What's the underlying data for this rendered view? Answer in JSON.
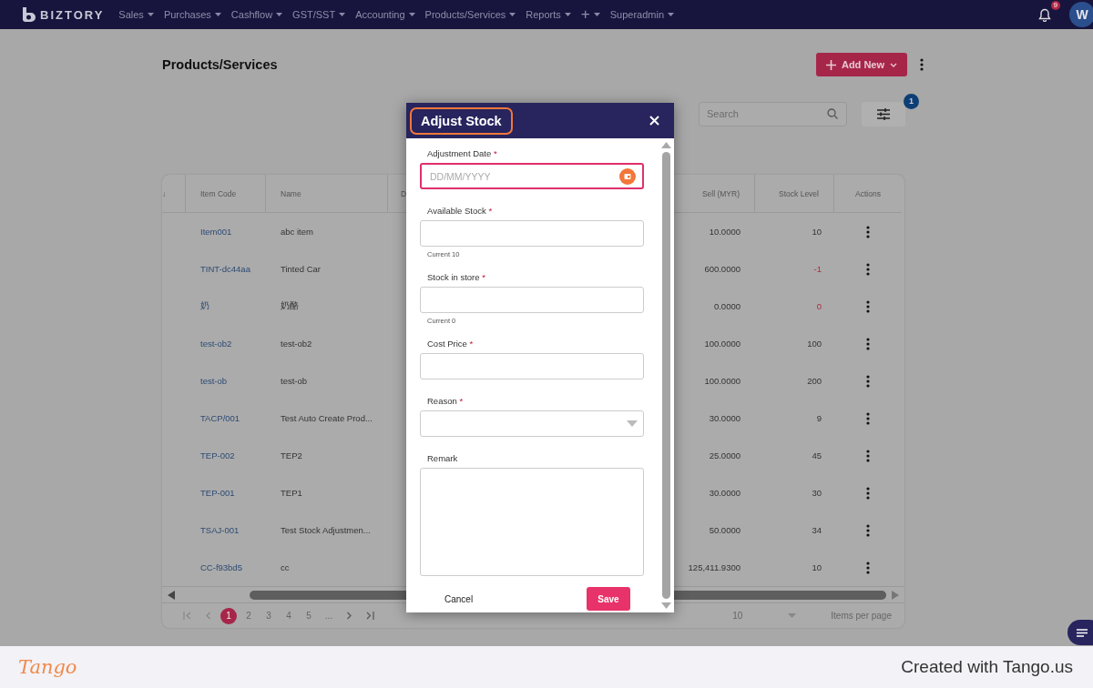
{
  "nav": {
    "brand": "BIZTORY",
    "menu": [
      {
        "label": "Sales"
      },
      {
        "label": "Purchases"
      },
      {
        "label": "Cashflow"
      },
      {
        "label": "GST/SST"
      },
      {
        "label": "Accounting"
      },
      {
        "label": "Products/Services"
      },
      {
        "label": "Reports"
      },
      {
        "label": "+"
      },
      {
        "label": "Superadmin"
      }
    ],
    "notification_count": "9",
    "avatar": "W"
  },
  "page": {
    "title": "Products/Services",
    "add_button": "Add New",
    "search": {
      "placeholder": "Search"
    },
    "filter_count": "1"
  },
  "table": {
    "columns": [
      "↓",
      "Item Code",
      "Name",
      "D",
      "Sell (MYR)",
      "Stock Level",
      "Actions"
    ],
    "rows": [
      {
        "item_code": "Item001",
        "name": "abc item",
        "sell": "10.0000",
        "stock_level": "10",
        "low_stock": false
      },
      {
        "item_code": "TINT-dc44aa",
        "name": "Tinted Car",
        "sell": "600.0000",
        "stock_level": "-1",
        "low_stock": true
      },
      {
        "item_code": "奶",
        "name": "奶酪",
        "sell": "0.0000",
        "stock_level": "0",
        "low_stock": true
      },
      {
        "item_code": "test-ob2",
        "name": "test-ob2",
        "sell": "100.0000",
        "stock_level": "100",
        "low_stock": false
      },
      {
        "item_code": "test-ob",
        "name": "test-ob",
        "sell": "100.0000",
        "stock_level": "200",
        "low_stock": false
      },
      {
        "item_code": "TACP/001",
        "name": "Test Auto Create Prod...",
        "sell": "30.0000",
        "stock_level": "9",
        "low_stock": false
      },
      {
        "item_code": "TEP-002",
        "name": "TEP2",
        "sell": "25.0000",
        "stock_level": "45",
        "low_stock": false
      },
      {
        "item_code": "TEP-001",
        "name": "TEP1",
        "sell": "30.0000",
        "stock_level": "30",
        "low_stock": false
      },
      {
        "item_code": "TSAJ-001",
        "name": "Test Stock Adjustmen...",
        "sell": "50.0000",
        "stock_level": "34",
        "low_stock": false
      },
      {
        "item_code": "CC-f93bd5",
        "name": "cc",
        "sell": "125,411.9300",
        "stock_level": "10",
        "low_stock": false
      }
    ]
  },
  "pagination": {
    "pages": [
      {
        "label": "1",
        "selected": true
      },
      {
        "label": "2",
        "selected": false
      },
      {
        "label": "3",
        "selected": false
      },
      {
        "label": "4",
        "selected": false
      },
      {
        "label": "5",
        "selected": false
      }
    ],
    "ellipsis": "...",
    "page_size": "10",
    "page_size_label": "Items per page"
  },
  "modal": {
    "title": "Adjust Stock",
    "fields": [
      {
        "kind": "date",
        "label": "Adjustment Date",
        "required_mark": "*",
        "placeholder": "DD/MM/YYYY",
        "focused": true
      },
      {
        "kind": "text",
        "label": "Available Stock",
        "required_mark": "*",
        "helper": "Current 10",
        "focused": false
      },
      {
        "kind": "text",
        "label": "Stock in store",
        "required_mark": "*",
        "helper": "Current 0",
        "focused": false
      },
      {
        "kind": "text",
        "label": "Cost Price",
        "required_mark": "*",
        "focused": false
      },
      {
        "kind": "select",
        "label": "Reason",
        "required_mark": "*",
        "focused": false
      },
      {
        "kind": "textarea",
        "label": "Remark",
        "focused": false
      }
    ],
    "cancel": "Cancel",
    "save": "Save"
  },
  "footer": {
    "logo": "Tango",
    "credit": "Created with Tango.us"
  }
}
